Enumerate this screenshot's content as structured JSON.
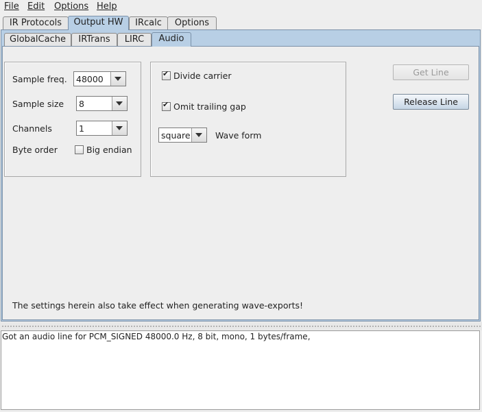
{
  "menubar": {
    "file": "File",
    "edit": "Edit",
    "options": "Options",
    "help": "Help"
  },
  "outer_tabs": [
    "IR Protocols",
    "Output HW",
    "IRcalc",
    "Options"
  ],
  "inner_tabs": [
    "GlobalCache",
    "IRTrans",
    "LIRC",
    "Audio"
  ],
  "audio": {
    "sample_freq_label": "Sample freq.",
    "sample_freq_value": "48000",
    "sample_size_label": "Sample size",
    "sample_size_value": "8",
    "channels_label": "Channels",
    "channels_value": "1",
    "byte_order_label": "Byte order",
    "big_endian_label": "Big endian",
    "big_endian_checked": false,
    "divide_carrier_label": "Divide carrier",
    "divide_carrier_checked": true,
    "omit_trailing_gap_label": "Omit trailing gap",
    "omit_trailing_gap_checked": true,
    "wave_form_value": "square",
    "wave_form_label": "Wave form",
    "get_line_label": "Get Line",
    "release_line_label": "Release Line",
    "note": "The settings herein also take effect when generating wave-exports!"
  },
  "console": {
    "text": "Got an audio line for PCM_SIGNED 48000.0 Hz, 8 bit, mono, 1 bytes/frame,"
  },
  "colors": {
    "tab_selected": "#b8cfe5",
    "panel_bg": "#eeeeee",
    "button_gradient_bottom": "#c6d6e6"
  }
}
